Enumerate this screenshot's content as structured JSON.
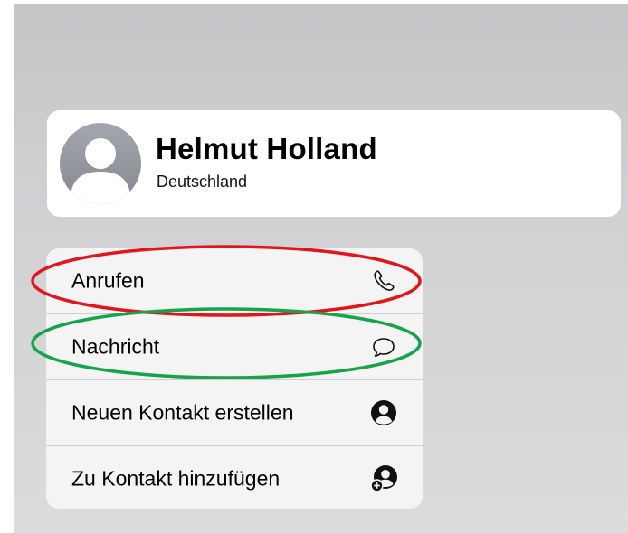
{
  "contact": {
    "name": "Helmut Holland",
    "country": "Deutschland",
    "avatar_icon": "person-placeholder-icon"
  },
  "menu": {
    "items": [
      {
        "label": "Anrufen",
        "icon": "phone-icon"
      },
      {
        "label": "Nachricht",
        "icon": "message-bubble-icon"
      },
      {
        "label": "Neuen Kontakt erstellen",
        "icon": "person-circle-icon"
      },
      {
        "label": "Zu Kontakt hinzufügen",
        "icon": "person-add-icon"
      }
    ]
  },
  "annotations": [
    {
      "target": "Anrufen",
      "shape": "ellipse",
      "color": "#e3151a"
    },
    {
      "target": "Nachricht",
      "shape": "ellipse",
      "color": "#17a34a"
    }
  ]
}
